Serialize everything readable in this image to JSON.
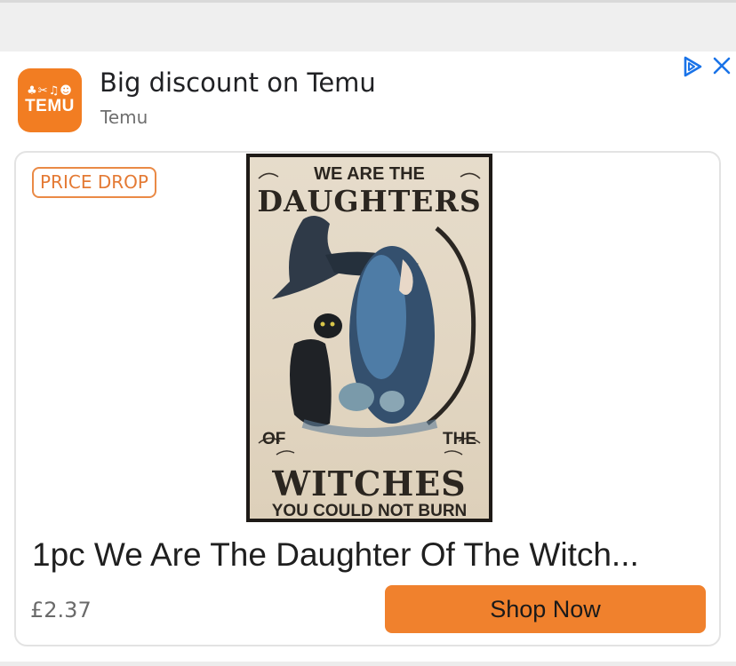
{
  "ad": {
    "title": "Big discount on Temu",
    "advertiser": "Temu",
    "app_icon": {
      "name": "temu-logo",
      "text": "TEMU",
      "glyphs": "♣✂♫☻",
      "color": "#f27d22"
    },
    "adchoices_icon": "adchoices-icon",
    "close_icon": "close-icon"
  },
  "card": {
    "badge": "PRICE DROP",
    "product_image": {
      "top_line": "WE ARE THE",
      "headline_1": "DAUGHTERS",
      "of": "OF",
      "the": "THE",
      "headline_2": "WITCHES",
      "bottom_line": "YOU COULD NOT BURN"
    },
    "product_title": "1pc We Are The Daughter Of The Witch...",
    "price": "£2.37",
    "cta": "Shop Now"
  },
  "colors": {
    "accent": "#f0812d",
    "badge": "#e47a34",
    "adchoices": "#1a73e8"
  }
}
